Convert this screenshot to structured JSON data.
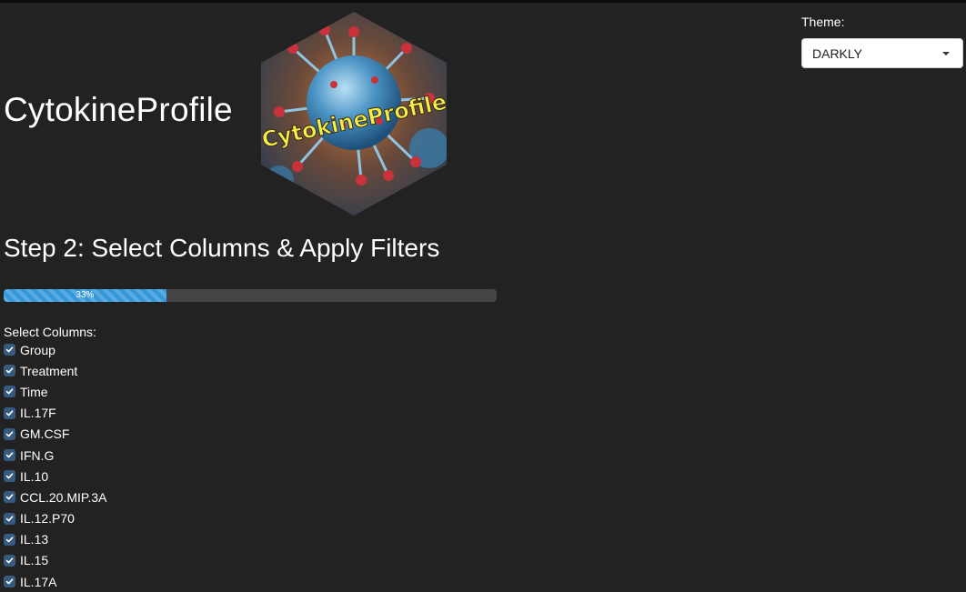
{
  "app": {
    "title": "CytokineProfile",
    "logo_text": "CytokineProfile"
  },
  "theme": {
    "label": "Theme:",
    "selected": "DARKLY"
  },
  "step": {
    "title": "Step 2: Select Columns & Apply Filters"
  },
  "progress": {
    "value": 0.33,
    "label": "33%"
  },
  "columns": {
    "label": "Select Columns:",
    "items": [
      {
        "label": "Group",
        "checked": true
      },
      {
        "label": "Treatment",
        "checked": true
      },
      {
        "label": "Time",
        "checked": true
      },
      {
        "label": "IL.17F",
        "checked": true
      },
      {
        "label": "GM.CSF",
        "checked": true
      },
      {
        "label": "IFN.G",
        "checked": true
      },
      {
        "label": "IL.10",
        "checked": true
      },
      {
        "label": "CCL.20.MIP.3A",
        "checked": true
      },
      {
        "label": "IL.12.P70",
        "checked": true
      },
      {
        "label": "IL.13",
        "checked": true
      },
      {
        "label": "IL.15",
        "checked": true
      },
      {
        "label": "IL.17A",
        "checked": true
      }
    ]
  },
  "colors": {
    "background": "#222222",
    "checkbox": "#375a7f",
    "progress_fill": "#3498db",
    "progress_track": "#444444"
  }
}
